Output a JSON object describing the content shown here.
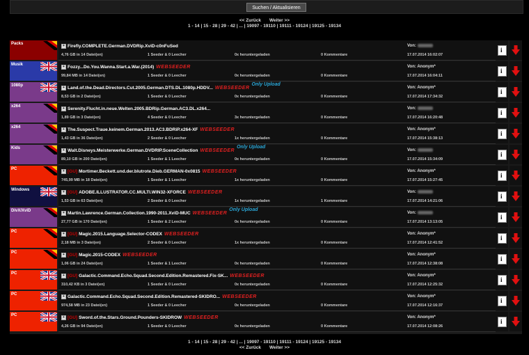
{
  "search": {
    "button_label": "Suchen / Aktualisieren"
  },
  "pagination": {
    "prev": "<< Zurück",
    "next": "Weiter >>",
    "pages": [
      "1 - 14",
      "15 - 28",
      "29 - 42",
      "...",
      "19097 - 19110",
      "19111 - 19124",
      "19125 - 19134"
    ]
  },
  "rows": [
    {
      "category": "Packs",
      "cat_color": "#8b0000",
      "flag": "de",
      "gu": false,
      "title": "Firefly.COMPLETE.German.DVDRip.XviD-c0nFuSed",
      "webseeder": false,
      "only_upload": false,
      "size": "4,76 GB in 14 Datei(en)",
      "seeder": "1 Seeder & 0 Leecher",
      "downloads": "0x heruntergeladen",
      "comments": "0 Kommentare",
      "von": "Von:",
      "von_blurred": true,
      "date": "17.07.2014 16:02:07"
    },
    {
      "category": "Musik",
      "cat_color": "#2a3aa8",
      "flag": "gb",
      "gu": false,
      "title": "Fozzy...Do.You.Wanna.Start.a.War.(2014)",
      "webseeder": true,
      "only_upload": false,
      "size": "99,84 MB in 14 Datei(en)",
      "seeder": "1 Seeder & 0 Leecher",
      "downloads": "0x heruntergeladen",
      "comments": "0 Kommentare",
      "von": "Von: Anonym*",
      "von_blurred": false,
      "date": "17.07.2014 16:04:11"
    },
    {
      "category": "1080p",
      "cat_color": "#7a3a8a",
      "flag": "gb",
      "gu": false,
      "title": "Land.of.the.Dead.Directors.Cut.2005.German.DTS.DL.1080p.HDDV...",
      "webseeder": true,
      "only_upload": true,
      "size": "8,53 GB in 2 Datei(en)",
      "seeder": "1 Seeder & 0 Leecher",
      "downloads": "0x heruntergeladen",
      "comments": "0 Kommentare",
      "von": "Von: Anonym*",
      "von_blurred": false,
      "date": "17.07.2014 17:34:32"
    },
    {
      "category": "x264",
      "cat_color": "#7a3a8a",
      "flag": "de",
      "gu": false,
      "title": "Serenity.Flucht.in.neue.Welten.2005.BDRip.German.AC3.DL.x264...",
      "webseeder": false,
      "only_upload": false,
      "size": "1,89 GB in 3 Datei(en)",
      "seeder": "4 Seeder & 0 Leecher",
      "downloads": "3x heruntergeladen",
      "comments": "0 Kommentare",
      "von": "Von:",
      "von_blurred": true,
      "date": "17.07.2014 16:20:48"
    },
    {
      "category": "x264",
      "cat_color": "#7a3a8a",
      "flag": "de",
      "gu": false,
      "title": "The.Suspect.Traue.keinem.German.2013.AC3.BDRiP.x264-XF",
      "webseeder": true,
      "only_upload": false,
      "size": "1,43 GB in 36 Datei(en)",
      "seeder": "2 Seeder & 0 Leecher",
      "downloads": "1x heruntergeladen",
      "comments": "0 Kommentare",
      "von": "Von: Anonym*",
      "von_blurred": false,
      "date": "17.07.2014 15:38:13"
    },
    {
      "category": "Kids",
      "cat_color": "#7a3a8a",
      "flag": "de",
      "gu": false,
      "title": "Walt.Disneys.Meisterwerke.German.DVDRIP.SceneCollection",
      "webseeder": true,
      "only_upload": true,
      "size": "89,10 GB in 200 Datei(en)",
      "seeder": "1 Seeder & 1 Leecher",
      "downloads": "0x heruntergeladen",
      "comments": "0 Kommentare",
      "von": "Von:",
      "von_blurred": true,
      "date": "17.07.2014 15:34:09"
    },
    {
      "category": "PC",
      "cat_color": "#ee2200",
      "flag": "de",
      "gu": true,
      "title": "Mortimer.Beckett.und.der.blutrote.Dieb.GERMAN-0x0815",
      "webseeder": true,
      "only_upload": false,
      "size": "745,99 MB in 18 Datei(en)",
      "seeder": "1 Seeder & 1 Leecher",
      "downloads": "1x heruntergeladen",
      "comments": "0 Kommentare",
      "von": "Von: Anonym*",
      "von_blurred": false,
      "date": "17.07.2014 15:27:45"
    },
    {
      "category": "Windows",
      "cat_color": "#101040",
      "flag": "gb",
      "gu": true,
      "title": "ADOBE.ILLUSTRATOR.CC.MULTI.WIN32-XFORCE",
      "webseeder": true,
      "only_upload": false,
      "size": "1,53 GB in 63 Datei(en)",
      "seeder": "2 Seeder & 0 Leecher",
      "downloads": "1x heruntergeladen",
      "comments": "1 Kommentare",
      "von": "Von:",
      "von_blurred": true,
      "date": "17.07.2014 14:21:06"
    },
    {
      "category": "DivX/XviD",
      "cat_color": "#7a3a8a",
      "flag": "de",
      "gu": false,
      "title": "Martin.Lawrence.German.Collection.1990-2011.XviD-MUC",
      "webseeder": true,
      "only_upload": true,
      "size": "27,77 GB in 170 Datei(en)",
      "seeder": "1 Seeder & 2 Leecher",
      "downloads": "0x heruntergeladen",
      "comments": "0 Kommentare",
      "von": "Von:",
      "von_blurred": true,
      "date": "17.07.2014 13:13:05"
    },
    {
      "category": "PC",
      "cat_color": "#ee2200",
      "flag": "de",
      "gu": true,
      "title": "Magic.2015.Language.Selector-CODEX",
      "webseeder": true,
      "only_upload": false,
      "size": "2,18 MB in 3 Datei(en)",
      "seeder": "2 Seeder & 0 Leecher",
      "downloads": "1x heruntergeladen",
      "comments": "0 Kommentare",
      "von": "Von: Anonym*",
      "von_blurred": false,
      "date": "17.07.2014 12:41:52"
    },
    {
      "category": "PC",
      "cat_color": "#ee2200",
      "flag": "de",
      "gu": true,
      "title": "Magic.2015-CODEX",
      "webseeder": true,
      "only_upload": false,
      "size": "1,06 GB in 24 Datei(en)",
      "seeder": "1 Seeder & 1 Leecher",
      "downloads": "0x heruntergeladen",
      "comments": "0 Kommentare",
      "von": "Von: Anonym*",
      "von_blurred": false,
      "date": "17.07.2014 12:38:08"
    },
    {
      "category": "PC",
      "cat_color": "#ee2200",
      "flag": "gb",
      "gu": true,
      "title": "Galactic.Command.Echo.Squad.Second.Edition.Remastered.Fix-SK...",
      "webseeder": true,
      "only_upload": false,
      "size": "310,42 KB in 3 Datei(en)",
      "seeder": "1 Seeder & 0 Leecher",
      "downloads": "0x heruntergeladen",
      "comments": "0 Kommentare",
      "von": "Von: Anonym*",
      "von_blurred": false,
      "date": "17.07.2014 12:25:32"
    },
    {
      "category": "PC",
      "cat_color": "#ee2200",
      "flag": "gb",
      "gu": false,
      "title": "Galactic.Command.Echo.Squad.Second.Edition.Remastered-SKIDRO...",
      "webseeder": true,
      "only_upload": false,
      "size": "974,58 MB in 23 Datei(en)",
      "seeder": "1 Seeder & 0 Leecher",
      "downloads": "0x heruntergeladen",
      "comments": "0 Kommentare",
      "von": "Von: Anonym*",
      "von_blurred": false,
      "date": "17.07.2014 12:16:37"
    },
    {
      "category": "PC",
      "cat_color": "#ee2200",
      "flag": "gb",
      "gu": true,
      "title": "Sword.of.the.Stars.Ground.Pounders-SKIDROW",
      "webseeder": true,
      "only_upload": false,
      "size": "4,26 GB in 94 Datei(en)",
      "seeder": "1 Seeder & 0 Leecher",
      "downloads": "0x heruntergeladen",
      "comments": "0 Kommentare",
      "von": "Von: Anonym*",
      "von_blurred": false,
      "date": "17.07.2014 12:08:26"
    }
  ],
  "badges": {
    "gu": "[GU]",
    "webseeder": "WEBSEEDER",
    "only_upload": "Only Upload",
    "plus": "+"
  },
  "colors": {
    "background": "#000000",
    "row": "#111111",
    "webseeder": "#e02020",
    "only_upload": "#2aa6d6",
    "download_arrow": "#e01010"
  }
}
